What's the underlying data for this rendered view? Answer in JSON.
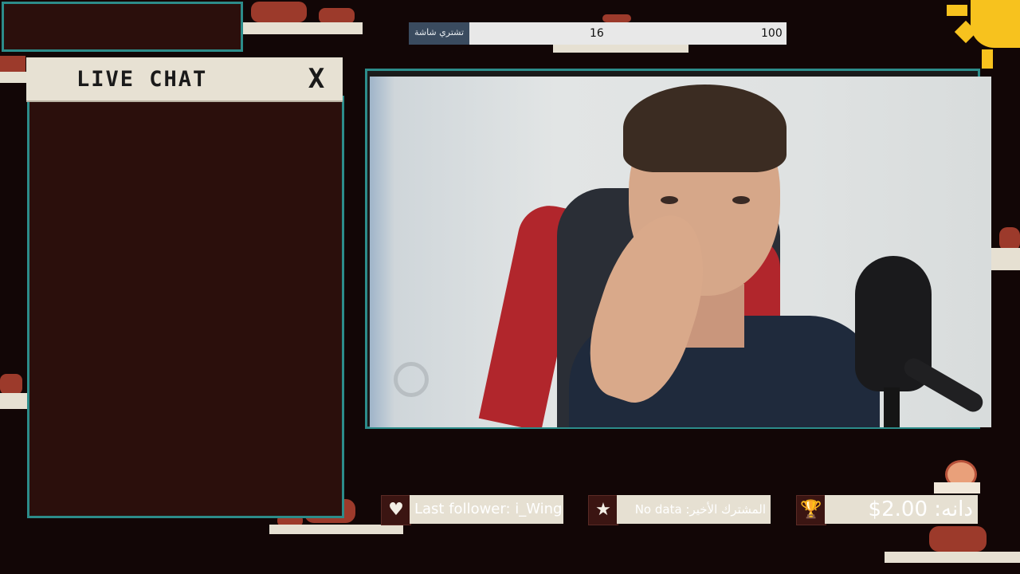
{
  "chat": {
    "title": "LIVE CHAT",
    "close_label": "X"
  },
  "goal": {
    "label": "تشتري شاشة",
    "current": 16,
    "target": 100,
    "current_label": "16",
    "target_label": "100"
  },
  "alerts": {
    "follower": "Last follower: i_Wing",
    "subscriber": "المشترك الأخير: No data",
    "donation": "دانه: 2.00$"
  },
  "icons": {
    "follower": "heart-icon",
    "subscriber": "star-icon",
    "donation": "trophy-icon"
  },
  "colors": {
    "accent": "#2c8c8a",
    "panel": "#2b0f0c",
    "background": "#120606",
    "bar": "#e6e0d2"
  }
}
